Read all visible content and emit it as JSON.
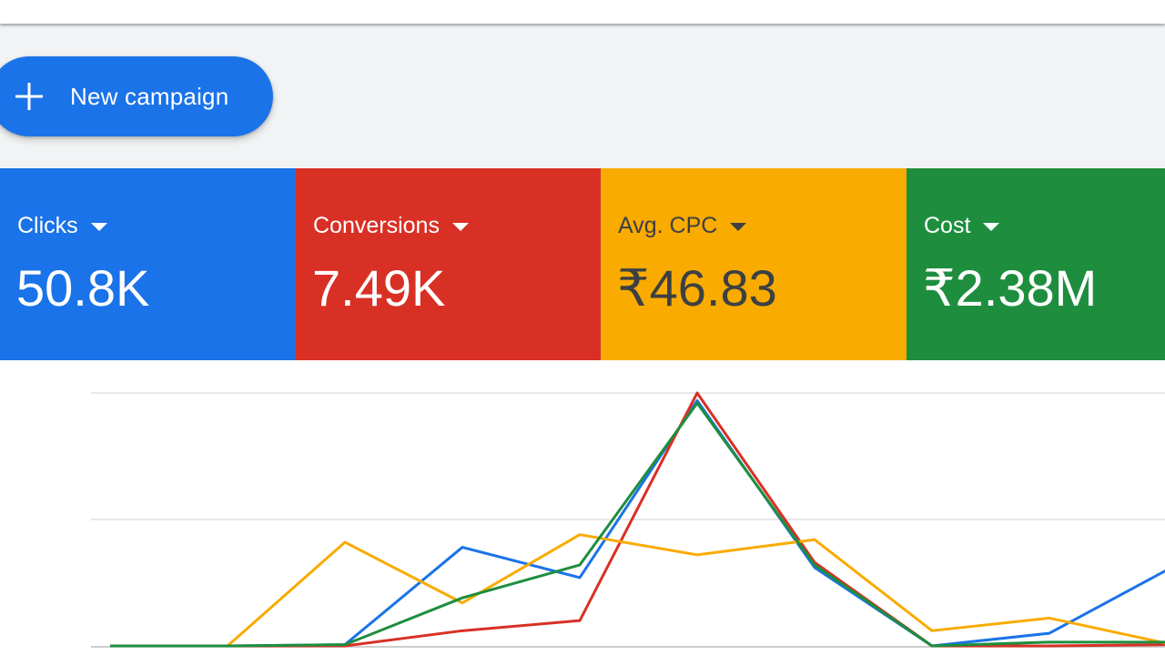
{
  "fab": {
    "label": "New campaign",
    "icon": "plus-icon"
  },
  "metrics": [
    {
      "name": "Clicks",
      "value": "50.8K",
      "bg": "#1a73e8",
      "fg": "#ffffff",
      "icon": "dropdown-caret-icon"
    },
    {
      "name": "Conversions",
      "value": "7.49K",
      "bg": "#d93025",
      "fg": "#ffffff",
      "icon": "dropdown-caret-icon"
    },
    {
      "name": "Avg. CPC",
      "value": "₹46.83",
      "bg": "#f9ab00",
      "fg": "#3c4043",
      "icon": "dropdown-caret-icon"
    },
    {
      "name": "Cost",
      "value": "₹2.38M",
      "bg": "#1e8e3e",
      "fg": "#ffffff",
      "icon": "dropdown-caret-icon"
    }
  ],
  "colors": {
    "top_bar": "#ffffff",
    "page_bg": "#f1f3f4",
    "gridline": "#e0e0e0",
    "baseline": "#bdbdbd"
  },
  "chart_data": {
    "type": "line",
    "grid": true,
    "legend": "none",
    "x": [
      0,
      1,
      2,
      3,
      4,
      5,
      6,
      7,
      8,
      9,
      10
    ],
    "ylim": [
      0,
      100
    ],
    "series": [
      {
        "color": "#1a73e8",
        "values": [
          0,
          0,
          0.5,
          39,
          27,
          97,
          31,
          0,
          5,
          30,
          null
        ]
      },
      {
        "color": "#d93025",
        "values": [
          0,
          0,
          0,
          6,
          10,
          100,
          33,
          0,
          0,
          0.5,
          null
        ]
      },
      {
        "color": "#f9ab00",
        "values": [
          0,
          0,
          41,
          17,
          44,
          36,
          42,
          6,
          11,
          1,
          null
        ]
      },
      {
        "color": "#1e8e3e",
        "values": [
          0,
          0,
          0.5,
          19,
          32,
          96,
          32,
          0,
          1.5,
          1.5,
          null
        ]
      }
    ]
  }
}
